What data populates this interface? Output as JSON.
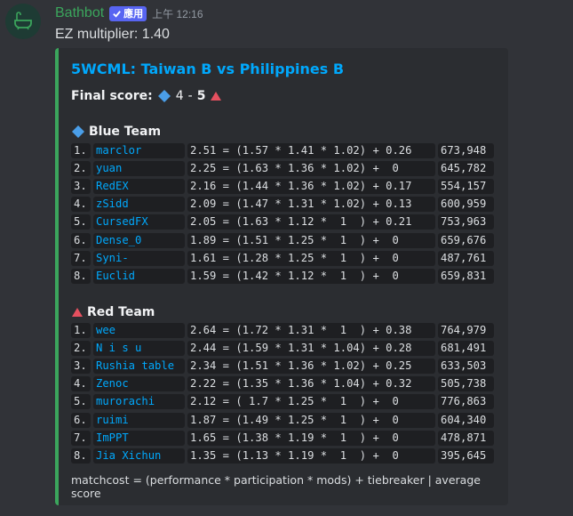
{
  "message": {
    "author": "Bathbot",
    "app_tag": "應用",
    "timestamp": "上午 12:16",
    "text": "EZ multiplier: 1.40"
  },
  "embed": {
    "title": "5WCML: Taiwan B vs Philippines B",
    "final_score_label": "Final score:",
    "blue_score": "4",
    "separator": "-",
    "red_score": "5",
    "blue_team": {
      "name": "Blue Team",
      "color": "#4a9ee8",
      "rows": [
        {
          "rank": "1.",
          "name": "marclor",
          "calc": "2.51 = (1.57 * 1.41 * 1.02) + 0.26",
          "score": "673,948"
        },
        {
          "rank": "2.",
          "name": "yuan",
          "calc": "2.25 = (1.63 * 1.36 * 1.02) +  0  ",
          "score": "645,782"
        },
        {
          "rank": "3.",
          "name": "RedEX",
          "calc": "2.16 = (1.44 * 1.36 * 1.02) + 0.17",
          "score": "554,157"
        },
        {
          "rank": "4.",
          "name": "zSidd",
          "calc": "2.09 = (1.47 * 1.31 * 1.02) + 0.13",
          "score": "600,959"
        },
        {
          "rank": "5.",
          "name": "CursedFX",
          "calc": "2.05 = (1.63 * 1.12 *  1  ) + 0.21",
          "score": "753,963"
        },
        {
          "rank": "6.",
          "name": "Dense_0",
          "calc": "1.89 = (1.51 * 1.25 *  1  ) +  0  ",
          "score": "659,676"
        },
        {
          "rank": "7.",
          "name": "Syni-",
          "calc": "1.61 = (1.28 * 1.25 *  1  ) +  0  ",
          "score": "487,761"
        },
        {
          "rank": "8.",
          "name": "Euclid",
          "calc": "1.59 = (1.42 * 1.12 *  1  ) +  0  ",
          "score": "659,831"
        }
      ]
    },
    "red_team": {
      "name": "Red Team",
      "color": "#e5505f",
      "rows": [
        {
          "rank": "1.",
          "name": "wee",
          "calc": "2.64 = (1.72 * 1.31 *  1  ) + 0.38",
          "score": "764,979"
        },
        {
          "rank": "2.",
          "name": "N i s u",
          "calc": "2.44 = (1.59 * 1.31 * 1.04) + 0.28",
          "score": "681,491"
        },
        {
          "rank": "3.",
          "name": "Rushia table",
          "calc": "2.34 = (1.51 * 1.36 * 1.02) + 0.25",
          "score": "633,503"
        },
        {
          "rank": "4.",
          "name": "Zenoc",
          "calc": "2.22 = (1.35 * 1.36 * 1.04) + 0.32",
          "score": "505,738"
        },
        {
          "rank": "5.",
          "name": "murorachi",
          "calc": "2.12 = ( 1.7 * 1.25 *  1  ) +  0  ",
          "score": "776,863"
        },
        {
          "rank": "6.",
          "name": "ruimi",
          "calc": "1.87 = (1.49 * 1.25 *  1  ) +  0  ",
          "score": "604,340"
        },
        {
          "rank": "7.",
          "name": "ImPPT",
          "calc": "1.65 = (1.38 * 1.19 *  1  ) +  0  ",
          "score": "478,871"
        },
        {
          "rank": "8.",
          "name": "Jia Xichun",
          "calc": "1.35 = (1.13 * 1.19 *  1  ) +  0  ",
          "score": "395,645"
        }
      ]
    },
    "footer": "matchcost = (performance * participation * mods) + tiebreaker | average score"
  },
  "colors": {
    "accent_green": "#3ba55c",
    "link_blue": "#00a8fc",
    "app_tag": "#5865f2"
  }
}
